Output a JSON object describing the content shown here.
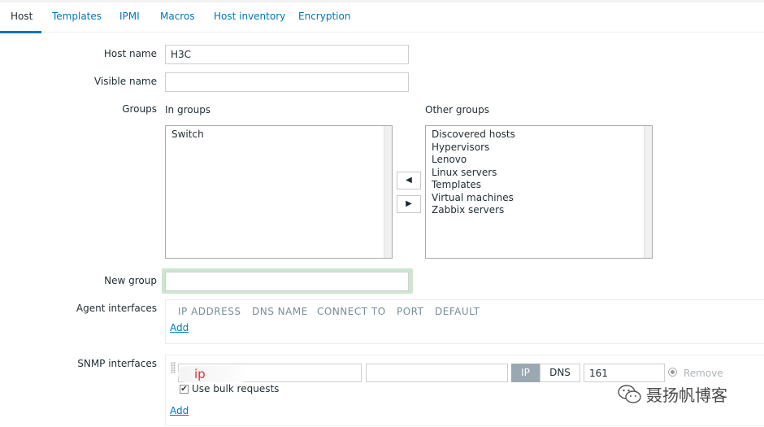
{
  "tabs": [
    "Host",
    "Templates",
    "IPMI",
    "Macros",
    "Host inventory",
    "Encryption"
  ],
  "form": {
    "host_name_label": "Host name",
    "host_name_value": "H3C",
    "visible_name_label": "Visible name",
    "visible_name_value": "",
    "groups_label": "Groups",
    "in_groups_label": "In groups",
    "other_groups_label": "Other groups",
    "in_groups": [
      "Switch"
    ],
    "other_groups": [
      "Discovered hosts",
      "Hypervisors",
      "Lenovo",
      "Linux servers",
      "Templates",
      "Virtual machines",
      "Zabbix servers"
    ],
    "move_left_glyph": "◀",
    "move_right_glyph": "▶",
    "new_group_label": "New group",
    "new_group_value": ""
  },
  "agent": {
    "label": "Agent interfaces",
    "columns": [
      "IP ADDRESS",
      "DNS NAME",
      "CONNECT TO",
      "PORT",
      "DEFAULT"
    ],
    "add_label": "Add"
  },
  "snmp": {
    "label": "SNMP interfaces",
    "ip_text": "ip",
    "dns_value": "",
    "connect_ip": "IP",
    "connect_dns": "DNS",
    "port_value": "161",
    "remove_label": "Remove",
    "bulk_label": "Use bulk requests",
    "bulk_checked": true,
    "add_label": "Add"
  },
  "watermark": {
    "text": "聂扬帆博客",
    "icon": "wechat-icon"
  }
}
